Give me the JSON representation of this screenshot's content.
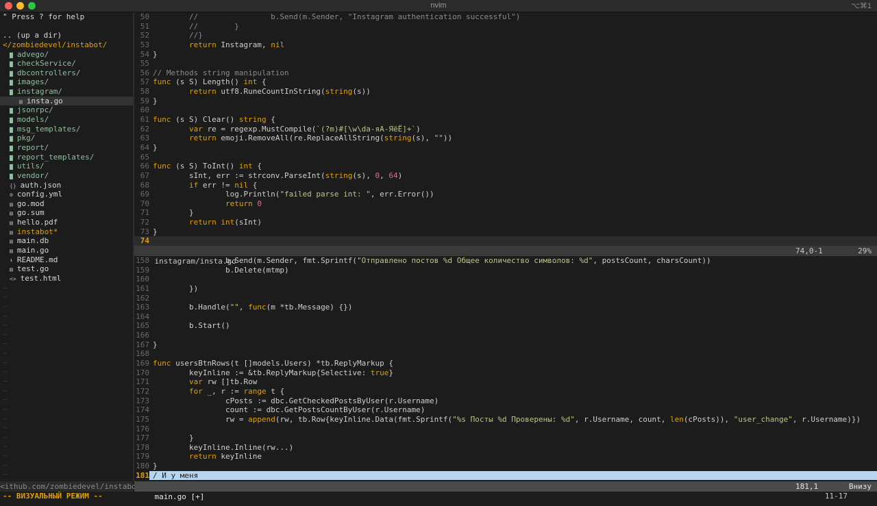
{
  "window": {
    "title": "nvim",
    "shortcut": "⌥⌘1"
  },
  "colors": {
    "keyword": "#e0a000",
    "string": "#b8c88a",
    "comment": "#8a8a8a",
    "number": "#d06f9a",
    "directory": "#8fbf9f",
    "visual": "#b8d5f0"
  },
  "tree": {
    "help": "\" Press ? for help",
    "up": ".. (up a dir)",
    "root": "</zombiedevel/instabot/",
    "entries": [
      {
        "icon": "folder-icon",
        "glyph": "▇",
        "label": "advego/",
        "kind": "dir"
      },
      {
        "icon": "folder-icon",
        "glyph": "▇",
        "label": "checkService/",
        "kind": "dir"
      },
      {
        "icon": "folder-icon",
        "glyph": "▇",
        "label": "dbcontrollers/",
        "kind": "dir"
      },
      {
        "icon": "folder-icon",
        "glyph": "▇",
        "label": "images/",
        "kind": "dir"
      },
      {
        "icon": "folder-icon",
        "glyph": "▇",
        "label": "instagram/",
        "kind": "dir"
      },
      {
        "icon": "file-icon",
        "glyph": "▤",
        "label": "insta.go",
        "kind": "file",
        "indent": true,
        "selected": true
      },
      {
        "icon": "folder-icon",
        "glyph": "▇",
        "label": "jsonrpc/",
        "kind": "dir"
      },
      {
        "icon": "folder-icon",
        "glyph": "▇",
        "label": "models/",
        "kind": "dir"
      },
      {
        "icon": "folder-icon",
        "glyph": "▇",
        "label": "msg_templates/",
        "kind": "dir"
      },
      {
        "icon": "folder-icon",
        "glyph": "▇",
        "label": "pkg/",
        "kind": "dir"
      },
      {
        "icon": "folder-icon",
        "glyph": "▇",
        "label": "report/",
        "kind": "dir"
      },
      {
        "icon": "folder-icon",
        "glyph": "▇",
        "label": "report_templates/",
        "kind": "dir"
      },
      {
        "icon": "folder-icon",
        "glyph": "▇",
        "label": "utils/",
        "kind": "dir"
      },
      {
        "icon": "folder-icon",
        "glyph": "▇",
        "label": "vendor/",
        "kind": "dir"
      },
      {
        "icon": "json-icon",
        "glyph": "{}",
        "label": "auth.json",
        "kind": "file"
      },
      {
        "icon": "gear-icon",
        "glyph": "⚙",
        "label": "config.yml",
        "kind": "file"
      },
      {
        "icon": "file-icon",
        "glyph": "▤",
        "label": "go.mod",
        "kind": "file"
      },
      {
        "icon": "file-icon",
        "glyph": "▤",
        "label": "go.sum",
        "kind": "file"
      },
      {
        "icon": "file-icon",
        "glyph": "▤",
        "label": "hello.pdf",
        "kind": "file"
      },
      {
        "icon": "file-icon",
        "glyph": "▤",
        "label": "instabot*",
        "kind": "exec"
      },
      {
        "icon": "file-icon",
        "glyph": "▤",
        "label": "main.db",
        "kind": "file"
      },
      {
        "icon": "file-icon",
        "glyph": "▤",
        "label": "main.go",
        "kind": "file"
      },
      {
        "icon": "download-icon",
        "glyph": "⬇",
        "label": "README.md",
        "kind": "file"
      },
      {
        "icon": "file-icon",
        "glyph": "▤",
        "label": "test.go",
        "kind": "file"
      },
      {
        "icon": "html-icon",
        "glyph": "<>",
        "label": "test.html",
        "kind": "file"
      }
    ],
    "statusline": "<ithub.com/zombiedevel/instabot"
  },
  "top_pane": {
    "lines": [
      {
        "n": "50",
        "t": [
          [
            "\t//\t\tb.Send(m.Sender, \"Instagram authentication successful\")",
            "c"
          ]
        ]
      },
      {
        "n": "51",
        "t": [
          [
            "\t//\t}",
            "c"
          ]
        ]
      },
      {
        "n": "52",
        "t": [
          [
            "\t//}",
            "c"
          ]
        ]
      },
      {
        "n": "53",
        "t": [
          [
            "\t",
            ""
          ],
          [
            "return",
            "k"
          ],
          [
            " Instagram, ",
            ""
          ],
          [
            "nil",
            "k"
          ]
        ]
      },
      {
        "n": "54",
        "t": [
          [
            "}",
            ""
          ]
        ]
      },
      {
        "n": "55",
        "t": []
      },
      {
        "n": "56",
        "t": [
          [
            "// Methods string manipulation",
            "c"
          ]
        ]
      },
      {
        "n": "57",
        "t": [
          [
            "func",
            "k"
          ],
          [
            " (s S) Length() ",
            ""
          ],
          [
            "int",
            "k"
          ],
          [
            " {",
            ""
          ]
        ]
      },
      {
        "n": "58",
        "t": [
          [
            "\t",
            ""
          ],
          [
            "return",
            "k"
          ],
          [
            " utf8.RuneCountInString(",
            ""
          ],
          [
            "string",
            "k"
          ],
          [
            "(s))",
            ""
          ]
        ]
      },
      {
        "n": "59",
        "t": [
          [
            "}",
            ""
          ]
        ]
      },
      {
        "n": "60",
        "t": []
      },
      {
        "n": "61",
        "t": [
          [
            "func",
            "k"
          ],
          [
            " (s S) Clear() ",
            ""
          ],
          [
            "string",
            "k"
          ],
          [
            " {",
            ""
          ]
        ]
      },
      {
        "n": "62",
        "t": [
          [
            "\t",
            ""
          ],
          [
            "var",
            "k"
          ],
          [
            " re = regexp.MustCompile(",
            ""
          ],
          [
            "`(?m)#[\\w\\dа-яА-ЯёЁ]+`",
            "s"
          ],
          [
            ")",
            ""
          ]
        ]
      },
      {
        "n": "63",
        "t": [
          [
            "\t",
            ""
          ],
          [
            "return",
            "k"
          ],
          [
            " emoji.RemoveAll(re.ReplaceAllString(",
            ""
          ],
          [
            "string",
            "k"
          ],
          [
            "(s), ",
            ""
          ],
          [
            "\"\"",
            "s"
          ],
          [
            "))",
            ""
          ]
        ]
      },
      {
        "n": "64",
        "t": [
          [
            "}",
            ""
          ]
        ]
      },
      {
        "n": "65",
        "t": []
      },
      {
        "n": "66",
        "t": [
          [
            "func",
            "k"
          ],
          [
            " (s S) ToInt() ",
            ""
          ],
          [
            "int",
            "k"
          ],
          [
            " {",
            ""
          ]
        ]
      },
      {
        "n": "67",
        "t": [
          [
            "\tsInt, err := strconv.ParseInt(",
            ""
          ],
          [
            "string",
            "k"
          ],
          [
            "(s), ",
            ""
          ],
          [
            "0",
            "n"
          ],
          [
            ", ",
            ""
          ],
          [
            "64",
            "n"
          ],
          [
            ")",
            ""
          ]
        ]
      },
      {
        "n": "68",
        "t": [
          [
            "\t",
            ""
          ],
          [
            "if",
            "k"
          ],
          [
            " err != ",
            ""
          ],
          [
            "nil",
            "k"
          ],
          [
            " {",
            ""
          ]
        ]
      },
      {
        "n": "69",
        "t": [
          [
            "\t\tlog.Println(",
            ""
          ],
          [
            "\"failed parse int: \"",
            "s"
          ],
          [
            ", err.Error())",
            ""
          ]
        ]
      },
      {
        "n": "70",
        "t": [
          [
            "\t\t",
            ""
          ],
          [
            "return",
            "k"
          ],
          [
            " ",
            ""
          ],
          [
            "0",
            "n"
          ]
        ]
      },
      {
        "n": "71",
        "t": [
          [
            "\t}",
            ""
          ]
        ]
      },
      {
        "n": "72",
        "t": [
          [
            "\t",
            ""
          ],
          [
            "return",
            "k"
          ],
          [
            " ",
            ""
          ],
          [
            "int",
            "k"
          ],
          [
            "(sInt)",
            ""
          ]
        ]
      },
      {
        "n": "73",
        "t": [
          [
            "}",
            ""
          ]
        ]
      },
      {
        "n": "74",
        "t": [],
        "cursor": true
      }
    ],
    "status": {
      "file": "instagram/insta.go",
      "pos": "74,0-1",
      "percent": "29%"
    }
  },
  "bottom_pane": {
    "lines": [
      {
        "n": "158",
        "t": [
          [
            "\t\tb.Send(m.Sender, fmt.Sprintf(",
            ""
          ],
          [
            "\"Отправлено постов %d Общее количество символов: %d\"",
            "s"
          ],
          [
            ", postsCount, charsCount))",
            ""
          ]
        ]
      },
      {
        "n": "159",
        "t": [
          [
            "\t\tb.Delete(mtmp)",
            ""
          ]
        ]
      },
      {
        "n": "160",
        "t": []
      },
      {
        "n": "161",
        "t": [
          [
            "\t})",
            ""
          ]
        ]
      },
      {
        "n": "162",
        "t": []
      },
      {
        "n": "163",
        "t": [
          [
            "\tb.Handle(",
            ""
          ],
          [
            "\"\"",
            "s"
          ],
          [
            ", ",
            ""
          ],
          [
            "func",
            "k"
          ],
          [
            "(m *tb.Message) {})",
            ""
          ]
        ]
      },
      {
        "n": "164",
        "t": []
      },
      {
        "n": "165",
        "t": [
          [
            "\tb.Start()",
            ""
          ]
        ]
      },
      {
        "n": "166",
        "t": []
      },
      {
        "n": "167",
        "t": [
          [
            "}",
            ""
          ]
        ]
      },
      {
        "n": "168",
        "t": []
      },
      {
        "n": "169",
        "t": [
          [
            "func",
            "k"
          ],
          [
            " usersBtnRows(t []models.Users) *tb.ReplyMarkup {",
            ""
          ]
        ]
      },
      {
        "n": "170",
        "t": [
          [
            "\tkeyInline := &tb.ReplyMarkup{Selective: ",
            ""
          ],
          [
            "true",
            "k"
          ],
          [
            "}",
            ""
          ]
        ]
      },
      {
        "n": "171",
        "t": [
          [
            "\t",
            ""
          ],
          [
            "var",
            "k"
          ],
          [
            " rw []tb.Row",
            ""
          ]
        ]
      },
      {
        "n": "172",
        "t": [
          [
            "\t",
            ""
          ],
          [
            "for",
            "k"
          ],
          [
            " _, r := ",
            ""
          ],
          [
            "range",
            "k"
          ],
          [
            " t {",
            ""
          ]
        ]
      },
      {
        "n": "173",
        "t": [
          [
            "\t\tcPosts := dbc.GetCheckedPostsByUser(r.Username)",
            ""
          ]
        ]
      },
      {
        "n": "174",
        "t": [
          [
            "\t\tcount := dbc.GetPostsCountByUser(r.Username)",
            ""
          ]
        ]
      },
      {
        "n": "175",
        "t": [
          [
            "\t\trw = ",
            ""
          ],
          [
            "append",
            "k"
          ],
          [
            "(rw, tb.Row{keyInline.Data(fmt.Sprintf(",
            ""
          ],
          [
            "\"%s Посты %d Проверены: %d\"",
            "s"
          ],
          [
            ", r.Username, count, ",
            ""
          ],
          [
            "len",
            "k"
          ],
          [
            "(cPosts)), ",
            ""
          ],
          [
            "\"user_change\"",
            "s"
          ],
          [
            ", r.Username)})",
            ""
          ]
        ]
      },
      {
        "n": "176",
        "t": []
      },
      {
        "n": "177",
        "t": [
          [
            "\t}",
            ""
          ]
        ]
      },
      {
        "n": "178",
        "t": [
          [
            "\tkeyInline.Inline(rw...)",
            ""
          ]
        ]
      },
      {
        "n": "179",
        "t": [
          [
            "\t",
            ""
          ],
          [
            "return",
            "k"
          ],
          [
            " keyInline",
            ""
          ]
        ]
      },
      {
        "n": "180",
        "t": [
          [
            "}",
            ""
          ]
        ]
      },
      {
        "n": "181",
        "t": [
          [
            "/ И у меня",
            ""
          ]
        ],
        "visual": true,
        "current": true
      }
    ],
    "status": {
      "file": "main.go [+]",
      "pos": "181,1",
      "percent": "Внизу"
    }
  },
  "mode": "-- ВИЗУАЛЬНЫЙ РЕЖИМ --",
  "selection": "11-17"
}
